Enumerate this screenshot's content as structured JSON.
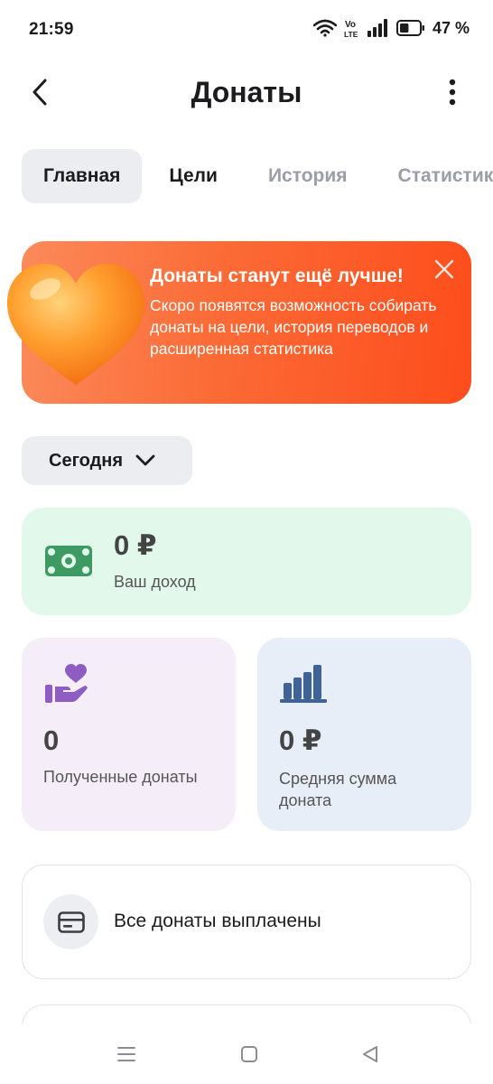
{
  "status_bar": {
    "time": "21:59",
    "battery_percent": "47 %",
    "battery_level": 0.47,
    "icons": [
      "wifi-icon",
      "volte-icon",
      "signal-icon",
      "battery-icon"
    ]
  },
  "header": {
    "title": "Донаты",
    "back_icon": "back-arrow-icon",
    "menu_icon": "more-vertical-icon"
  },
  "tabs": [
    {
      "label": "Главная",
      "active": true
    },
    {
      "label": "Цели",
      "active": false
    },
    {
      "label": "История",
      "active": false
    },
    {
      "label": "Статистика",
      "active": false
    }
  ],
  "promo": {
    "title": "Донаты станут ещё лучше!",
    "text": "Скоро появятся возможность собирать донаты на цели, история переводов и расширенная статистика",
    "icon": "heart-icon",
    "close_icon": "close-icon"
  },
  "period": {
    "label": "Сегодня",
    "icon": "chevron-down-icon"
  },
  "income": {
    "value": "0 ₽",
    "label": "Ваш доход",
    "icon": "banknote-icon"
  },
  "received": {
    "value": "0",
    "label": "Полученные донаты",
    "icon": "hand-heart-icon"
  },
  "average": {
    "value": "0 ₽",
    "label": "Средняя сумма доната",
    "icon": "bar-chart-icon"
  },
  "payout": {
    "label": "Все донаты выплачены",
    "icon": "credit-card-icon"
  },
  "colors": {
    "promo_start": "#fb8a5a",
    "promo_end": "#fd4d1c",
    "income_bg": "#e2f8ea",
    "income_icon": "#3e9a63",
    "received_bg": "#f5eef8",
    "received_icon": "#8e5cc2",
    "average_bg": "#e7eef8",
    "average_icon": "#3f6394"
  },
  "nav": {
    "icons": [
      "menu-icon",
      "home-icon",
      "back-icon"
    ]
  }
}
